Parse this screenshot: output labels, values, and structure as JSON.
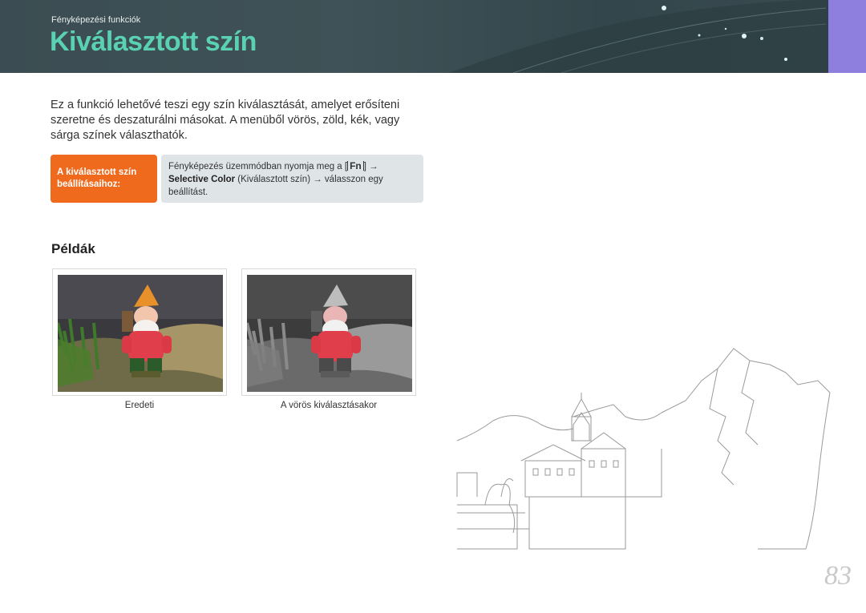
{
  "header": {
    "section_label": "Fényképezési funkciók",
    "title": "Kiválasztott szín",
    "accent_color": "#8e7fde",
    "title_color": "#5ad1b3"
  },
  "intro": {
    "text": "Ez a funkció lehetővé teszi egy szín kiválasztását, amelyet erősíteni szeretne és deszaturálni másokat. A menüből vörös, zöld, kék, vagy sárga színek választhatók."
  },
  "howto": {
    "label": "A kiválasztott szín beállításaihoz:",
    "step_prefix": "Fényképezés üzemmódban nyomja meg a [",
    "fn_key": "Fn",
    "step_arrow": "] →",
    "menu_item": "Selective Color",
    "step_suffix": " (Kiválasztott szín) → válasszon egy beállítást.",
    "label_color": "#f06a1e"
  },
  "examples": {
    "heading": "Példák",
    "photos": [
      {
        "caption": "Eredeti",
        "icon": "gnome-photo-color"
      },
      {
        "caption": "A vörös kiválasztásakor",
        "icon": "gnome-photo-selective-red"
      }
    ]
  },
  "page_number": "83"
}
